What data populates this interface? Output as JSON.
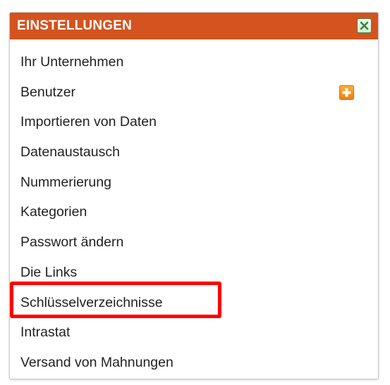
{
  "header": {
    "title": "EINSTELLUNGEN",
    "accent_color": "#d4531f",
    "close_icon": "close-x-icon"
  },
  "menu": {
    "items": [
      {
        "label": "Ihr Unternehmen"
      },
      {
        "label": "Benutzer",
        "action_icon": "add-plus-icon"
      },
      {
        "label": "Importieren von Daten"
      },
      {
        "label": "Datenaustausch"
      },
      {
        "label": "Nummerierung"
      },
      {
        "label": "Kategorien"
      },
      {
        "label": "Passwort ändern"
      },
      {
        "label": "Die Links"
      },
      {
        "label": "Schlüsselverzeichnisse",
        "highlighted": true
      },
      {
        "label": "Intrastat"
      },
      {
        "label": "Versand von Mahnungen"
      }
    ]
  },
  "highlight_color": "#ff0000"
}
